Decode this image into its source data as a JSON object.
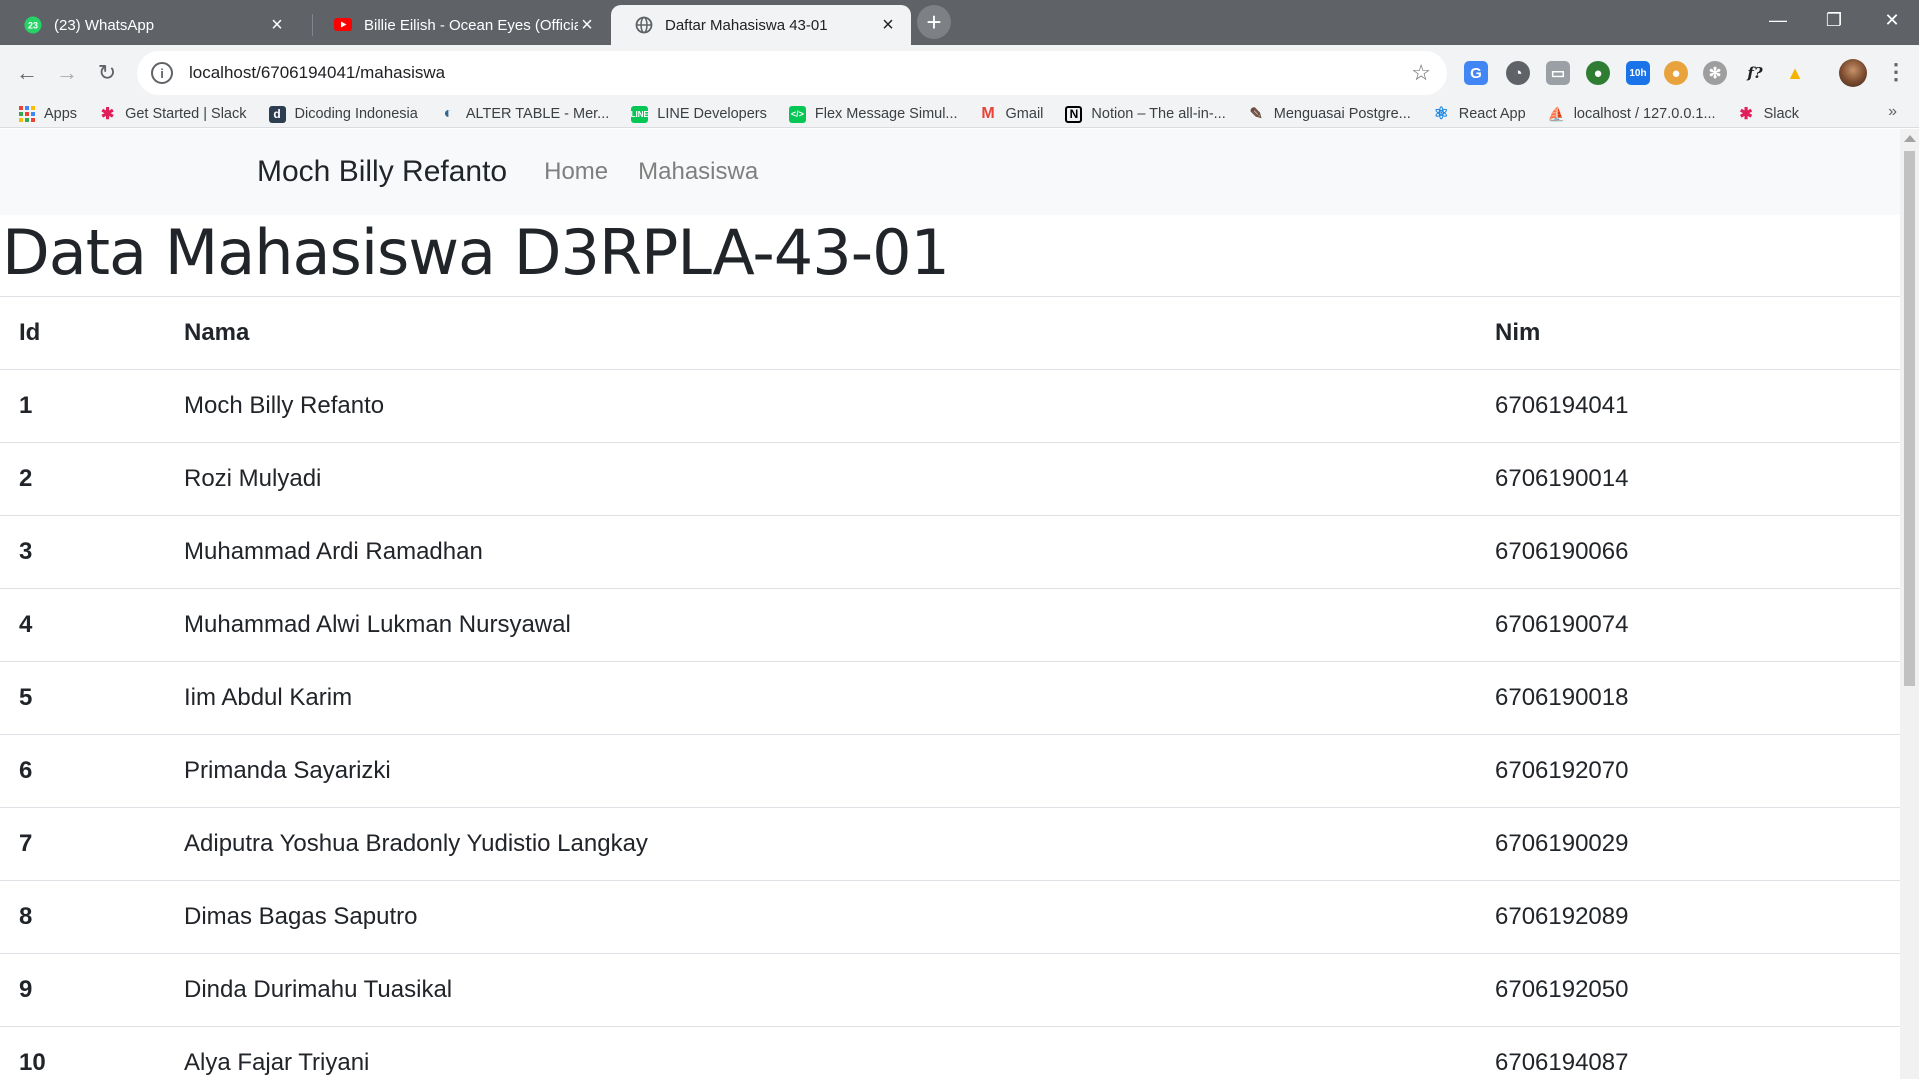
{
  "browser": {
    "tabs": [
      {
        "title": "(23) WhatsApp",
        "active": false
      },
      {
        "title": "Billie Eilish - Ocean Eyes (Official",
        "active": false
      },
      {
        "title": "Daftar Mahasiswa 43-01",
        "active": true
      }
    ],
    "whatsapp_badge": "23",
    "url": "localhost/6706194041/mahasiswa",
    "extension_badge": "10h",
    "bookmarks": [
      {
        "label": "Apps",
        "icon": "apps-grid-icon"
      },
      {
        "label": "Get Started | Slack",
        "icon": "slack-icon"
      },
      {
        "label": "Dicoding Indonesia",
        "icon": "dicoding-icon"
      },
      {
        "label": "ALTER TABLE - Mer...",
        "icon": "globe-icon"
      },
      {
        "label": "LINE Developers",
        "icon": "line-icon"
      },
      {
        "label": "Flex Message Simul...",
        "icon": "code-icon"
      },
      {
        "label": "Gmail",
        "icon": "gmail-icon"
      },
      {
        "label": "Notion – The all-in-...",
        "icon": "notion-icon"
      },
      {
        "label": "Menguasai Postgre...",
        "icon": "feather-icon"
      },
      {
        "label": "React App",
        "icon": "react-icon"
      },
      {
        "label": "localhost / 127.0.0.1...",
        "icon": "phpmyadmin-icon"
      },
      {
        "label": "Slack",
        "icon": "slack-icon"
      }
    ],
    "bookmarks_more": "»"
  },
  "site": {
    "brand": "Moch Billy Refanto",
    "nav": [
      "Home",
      "Mahasiswa"
    ]
  },
  "page": {
    "title": "Data Mahasiswa D3RPLA-43-01",
    "table": {
      "headers": [
        "Id",
        "Nama",
        "Nim"
      ],
      "rows": [
        {
          "id": "1",
          "nama": "Moch Billy Refanto",
          "nim": "6706194041"
        },
        {
          "id": "2",
          "nama": "Rozi Mulyadi",
          "nim": "6706190014"
        },
        {
          "id": "3",
          "nama": "Muhammad Ardi Ramadhan",
          "nim": "6706190066"
        },
        {
          "id": "4",
          "nama": "Muhammad Alwi Lukman Nursyawal",
          "nim": "6706190074"
        },
        {
          "id": "5",
          "nama": "Iim Abdul Karim",
          "nim": "6706190018"
        },
        {
          "id": "6",
          "nama": "Primanda Sayarizki",
          "nim": "6706192070"
        },
        {
          "id": "7",
          "nama": "Adiputra Yoshua Bradonly Yudistio Langkay",
          "nim": "6706190029"
        },
        {
          "id": "8",
          "nama": "Dimas Bagas Saputro",
          "nim": "6706192089"
        },
        {
          "id": "9",
          "nama": "Dinda Durimahu Tuasikal",
          "nim": "6706192050"
        },
        {
          "id": "10",
          "nama": "Alya Fajar Triyani",
          "nim": "6706194087"
        }
      ]
    }
  },
  "colors": {
    "tabstrip": "#5f6368",
    "toolbar": "#f1f3f4",
    "navbar": "#f8f9fa",
    "text": "#212529",
    "nav_link": "#7f7f7f",
    "border": "#dee2e6"
  }
}
